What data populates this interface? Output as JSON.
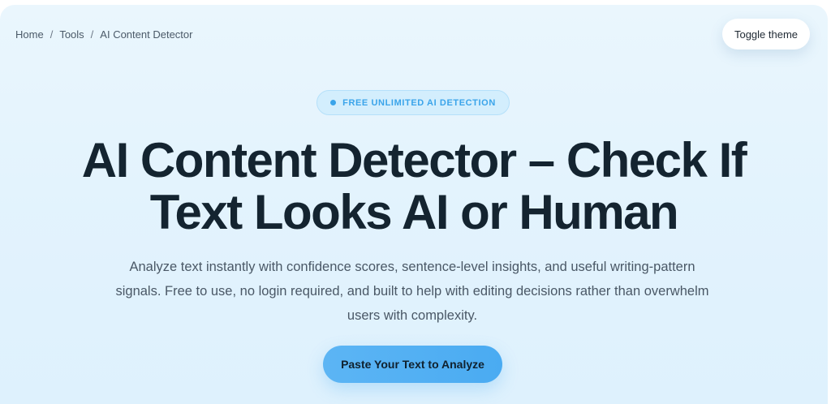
{
  "breadcrumb": {
    "items": [
      "Home",
      "Tools",
      "AI Content Detector"
    ],
    "separator": "/"
  },
  "header": {
    "toggle_theme_label": "Toggle theme"
  },
  "hero": {
    "badge": "FREE UNLIMITED AI DETECTION",
    "title": "AI Content Detector – Check If Text Looks AI or Human",
    "subtitle": "Analyze text instantly with confidence scores, sentence-level insights, and useful writing-pattern signals. Free to use, no login required, and built to help with editing decisions rather than overwhelm users with complexity.",
    "cta_label": "Paste Your Text to Analyze"
  },
  "colors": {
    "accent": "#4aabf2",
    "badge_text": "#3aa4ea",
    "title_text": "#142430",
    "background": "#e3f3fd"
  }
}
